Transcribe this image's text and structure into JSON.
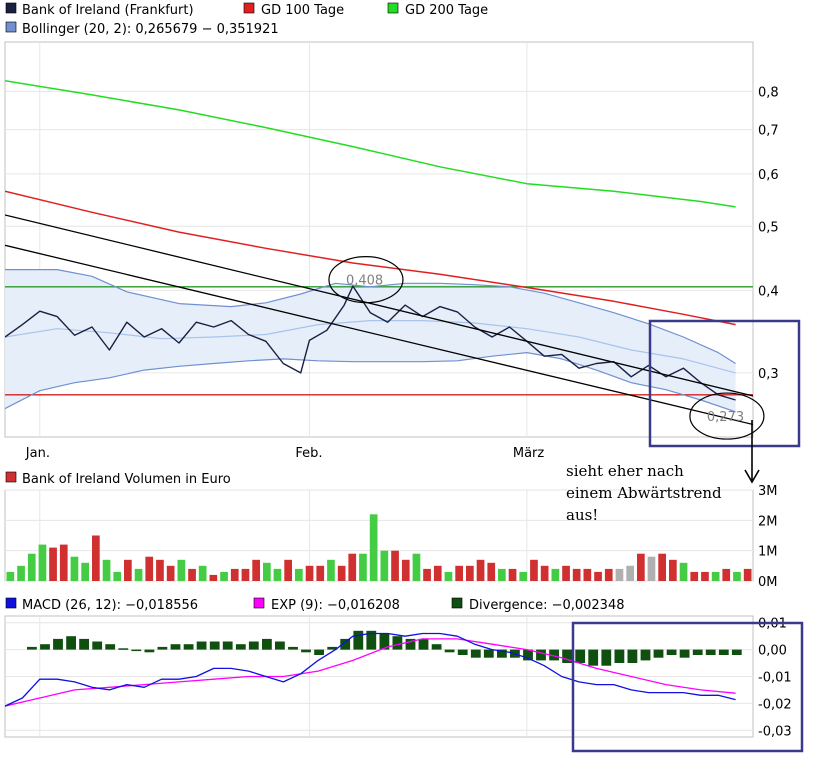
{
  "chart_data": [
    {
      "type": "line",
      "panel": "price",
      "legend": [
        {
          "label": "Bank of Ireland (Frankfurt)",
          "color": "#1a2040"
        },
        {
          "label": "GD 100 Tage",
          "color": "#e02020"
        },
        {
          "label": "GD 200 Tage",
          "color": "#22dd22"
        },
        {
          "label": "Bollinger (20, 2): 0,265679 − 0,351921",
          "color": "#7090d0"
        }
      ],
      "x_tick_labels": [
        "Jan.",
        "Feb.",
        "März"
      ],
      "y_tick_labels": [
        "0,3",
        "0,4",
        "0,5",
        "0,6",
        "0,7",
        "0,8"
      ],
      "y_ticks": [
        0.3,
        0.4,
        0.5,
        0.6,
        0.7,
        0.8
      ],
      "ylim": [
        0.24,
        0.95
      ],
      "log_scale": true,
      "x_range": [
        0,
        86
      ],
      "x_tick_positions": [
        4,
        35,
        60
      ],
      "series": [
        {
          "name": "Bank of Ireland (Frankfurt)",
          "color": "#1a2040",
          "x": [
            0,
            2,
            4,
            6,
            8,
            10,
            12,
            14,
            16,
            18,
            20,
            22,
            24,
            26,
            28,
            30,
            32,
            34,
            35,
            37,
            39,
            40,
            42,
            44,
            46,
            48,
            50,
            52,
            54,
            56,
            58,
            60,
            62,
            64,
            66,
            68,
            70,
            72,
            74,
            76,
            78,
            80,
            82,
            84
          ],
          "values": [
            0.34,
            0.355,
            0.372,
            0.365,
            0.342,
            0.352,
            0.325,
            0.358,
            0.34,
            0.35,
            0.333,
            0.358,
            0.352,
            0.36,
            0.343,
            0.335,
            0.31,
            0.3,
            0.336,
            0.348,
            0.38,
            0.406,
            0.37,
            0.358,
            0.38,
            0.365,
            0.378,
            0.371,
            0.352,
            0.34,
            0.352,
            0.335,
            0.318,
            0.32,
            0.305,
            0.31,
            0.312,
            0.296,
            0.308,
            0.296,
            0.305,
            0.29,
            0.278,
            0.273
          ]
        },
        {
          "name": "GD 100 Tage",
          "color": "#e02020",
          "x": [
            0,
            10,
            20,
            30,
            40,
            50,
            60,
            70,
            78,
            84
          ],
          "values": [
            0.565,
            0.525,
            0.49,
            0.463,
            0.44,
            0.423,
            0.404,
            0.385,
            0.368,
            0.355
          ]
        },
        {
          "name": "GD 200 Tage",
          "color": "#22dd22",
          "x": [
            0,
            10,
            20,
            30,
            40,
            50,
            60,
            70,
            80,
            84
          ],
          "values": [
            0.83,
            0.79,
            0.75,
            0.705,
            0.66,
            0.615,
            0.58,
            0.565,
            0.545,
            0.535
          ]
        },
        {
          "name": "Bollinger upper",
          "color": "#7090d0",
          "x": [
            0,
            6,
            10,
            14,
            20,
            26,
            30,
            34,
            38,
            42,
            46,
            50,
            54,
            58,
            62,
            66,
            70,
            74,
            78,
            82,
            84
          ],
          "values": [
            0.43,
            0.43,
            0.42,
            0.398,
            0.382,
            0.378,
            0.383,
            0.395,
            0.41,
            0.405,
            0.41,
            0.41,
            0.408,
            0.405,
            0.396,
            0.383,
            0.37,
            0.356,
            0.34,
            0.322,
            0.31
          ]
        },
        {
          "name": "Bollinger lower",
          "color": "#7090d0",
          "x": [
            0,
            4,
            8,
            12,
            16,
            20,
            24,
            28,
            32,
            36,
            40,
            44,
            48,
            52,
            56,
            60,
            64,
            68,
            72,
            76,
            80,
            84
          ],
          "values": [
            0.265,
            0.282,
            0.29,
            0.295,
            0.303,
            0.307,
            0.31,
            0.313,
            0.315,
            0.313,
            0.312,
            0.312,
            0.312,
            0.313,
            0.318,
            0.322,
            0.315,
            0.303,
            0.29,
            0.283,
            0.273,
            0.262
          ]
        },
        {
          "name": "Bollinger middle",
          "color": "#a8c4ec",
          "x": [
            0,
            6,
            12,
            18,
            24,
            30,
            36,
            42,
            48,
            54,
            60,
            66,
            72,
            78,
            84
          ],
          "values": [
            0.34,
            0.35,
            0.345,
            0.338,
            0.34,
            0.343,
            0.355,
            0.36,
            0.36,
            0.357,
            0.35,
            0.34,
            0.325,
            0.315,
            0.3
          ]
        },
        {
          "name": "Trendlinie 1",
          "color": "#000000",
          "x": [
            0,
            92
          ],
          "values": [
            0.52,
            0.265
          ]
        },
        {
          "name": "Trendlinie 2",
          "color": "#000000",
          "x": [
            0,
            92
          ],
          "values": [
            0.468,
            0.24
          ]
        },
        {
          "name": "Horizontal grün",
          "color": "#2c9a2c",
          "x": [
            0,
            92
          ],
          "values": [
            0.405,
            0.405
          ]
        },
        {
          "name": "Horizontal rot",
          "color": "#d42020",
          "x": [
            0,
            92
          ],
          "values": [
            0.278,
            0.278
          ]
        }
      ],
      "annotations": [
        {
          "text": "0,408",
          "x": 41.5,
          "y": 0.408
        },
        {
          "text": "0,273",
          "x": 83,
          "y": 0.272
        }
      ]
    },
    {
      "type": "bar",
      "panel": "volume",
      "legend": [
        {
          "label": "Bank of Ireland Volumen in Euro",
          "color": "#d03030"
        }
      ],
      "y_tick_labels": [
        "0M",
        "1M",
        "2M",
        "3M"
      ],
      "y_ticks": [
        0,
        1,
        2,
        3
      ],
      "ylim": [
        0,
        3
      ],
      "x_range": [
        0,
        86
      ],
      "values": [
        0.3,
        0.5,
        0.9,
        1.2,
        1.1,
        1.2,
        0.8,
        0.6,
        1.5,
        0.7,
        0.3,
        0.7,
        0.4,
        0.8,
        0.7,
        0.5,
        0.7,
        0.4,
        0.5,
        0.2,
        0.3,
        0.4,
        0.4,
        0.7,
        0.6,
        0.4,
        0.7,
        0.4,
        0.5,
        0.5,
        0.7,
        0.5,
        0.9,
        0.9,
        2.2,
        1.0,
        1.0,
        0.7,
        0.9,
        0.4,
        0.5,
        0.3,
        0.5,
        0.5,
        0.7,
        0.6,
        0.4,
        0.4,
        0.3,
        0.7,
        0.5,
        0.4,
        0.5,
        0.4,
        0.4,
        0.3,
        0.4,
        0.4,
        0.5,
        0.9,
        0.8,
        0.9,
        0.7,
        0.6,
        0.3,
        0.3,
        0.3,
        0.4,
        0.3,
        0.4
      ],
      "colors": [
        "g",
        "g",
        "g",
        "g",
        "r",
        "r",
        "g",
        "g",
        "r",
        "g",
        "g",
        "r",
        "g",
        "r",
        "r",
        "r",
        "g",
        "r",
        "g",
        "r",
        "g",
        "r",
        "r",
        "r",
        "g",
        "g",
        "r",
        "g",
        "r",
        "r",
        "g",
        "r",
        "r",
        "g",
        "g",
        "g",
        "r",
        "r",
        "g",
        "r",
        "r",
        "g",
        "r",
        "r",
        "r",
        "r",
        "g",
        "r",
        "g",
        "r",
        "r",
        "g",
        "r",
        "r",
        "r",
        "r",
        "r",
        "s",
        "s",
        "r",
        "s",
        "r",
        "r",
        "g",
        "r",
        "r",
        "g",
        "r",
        "g",
        "r"
      ]
    },
    {
      "type": "line",
      "panel": "macd",
      "legend": [
        {
          "label": "MACD (26, 12): −0,018556",
          "color": "#1010e0"
        },
        {
          "label": "EXP (9): −0,016208",
          "color": "#ff00ff"
        },
        {
          "label": "Divergence: −0,002348",
          "color": "#0f4f0f"
        }
      ],
      "y_tick_labels": [
        "0,01",
        "0,00",
        "-0,01",
        "-0,02",
        "-0,03"
      ],
      "y_ticks": [
        0.01,
        0,
        -0.01,
        -0.02,
        -0.03
      ],
      "ylim": [
        -0.0325,
        0.0125
      ],
      "x_range": [
        0,
        86
      ],
      "series": [
        {
          "name": "MACD (26, 12)",
          "color": "#1010e0",
          "x": [
            0,
            2,
            4,
            6,
            8,
            10,
            12,
            14,
            16,
            18,
            20,
            22,
            24,
            26,
            28,
            30,
            32,
            34,
            36,
            38,
            40,
            42,
            44,
            46,
            48,
            50,
            52,
            54,
            56,
            58,
            60,
            62,
            64,
            66,
            68,
            70,
            72,
            74,
            76,
            78,
            80,
            82,
            84
          ],
          "values": [
            -0.021,
            -0.018,
            -0.011,
            -0.011,
            -0.012,
            -0.014,
            -0.015,
            -0.013,
            -0.014,
            -0.011,
            -0.011,
            -0.01,
            -0.007,
            -0.007,
            -0.008,
            -0.01,
            -0.012,
            -0.009,
            -0.004,
            0.0,
            0.005,
            0.006,
            0.006,
            0.005,
            0.006,
            0.006,
            0.005,
            0.002,
            0.0,
            -0.001,
            -0.003,
            -0.006,
            -0.01,
            -0.012,
            -0.013,
            -0.013,
            -0.015,
            -0.016,
            -0.016,
            -0.016,
            -0.017,
            -0.017,
            -0.0186
          ]
        },
        {
          "name": "EXP (9)",
          "color": "#ff00ff",
          "x": [
            0,
            4,
            8,
            12,
            16,
            20,
            24,
            28,
            32,
            36,
            40,
            44,
            48,
            52,
            56,
            60,
            64,
            68,
            72,
            76,
            80,
            84
          ],
          "values": [
            -0.021,
            -0.018,
            -0.015,
            -0.014,
            -0.013,
            -0.012,
            -0.011,
            -0.01,
            -0.01,
            -0.008,
            -0.004,
            0.001,
            0.004,
            0.004,
            0.002,
            0.0,
            -0.003,
            -0.007,
            -0.01,
            -0.013,
            -0.015,
            -0.0162
          ]
        }
      ],
      "divergence": [
        0.001,
        0.002,
        0.004,
        0.005,
        0.004,
        0.003,
        0.002,
        0.0005,
        -0.0005,
        -0.001,
        0.001,
        0.002,
        0.002,
        0.003,
        0.003,
        0.003,
        0.002,
        0.003,
        0.004,
        0.003,
        0.001,
        -0.001,
        -0.002,
        0.001,
        0.004,
        0.007,
        0.007,
        0.006,
        0.005,
        0.004,
        0.004,
        0.002,
        -0.001,
        -0.002,
        -0.003,
        -0.003,
        -0.003,
        -0.003,
        -0.004,
        -0.004,
        -0.004,
        -0.005,
        -0.005,
        -0.006,
        -0.006,
        -0.005,
        -0.005,
        -0.004,
        -0.003,
        -0.002,
        -0.003,
        -0.002,
        -0.002,
        -0.002,
        -0.002
      ]
    }
  ],
  "annotation_text": {
    "line1": "sieht eher nach",
    "line2": "einem Abwärtstrend",
    "line3": "aus!"
  }
}
